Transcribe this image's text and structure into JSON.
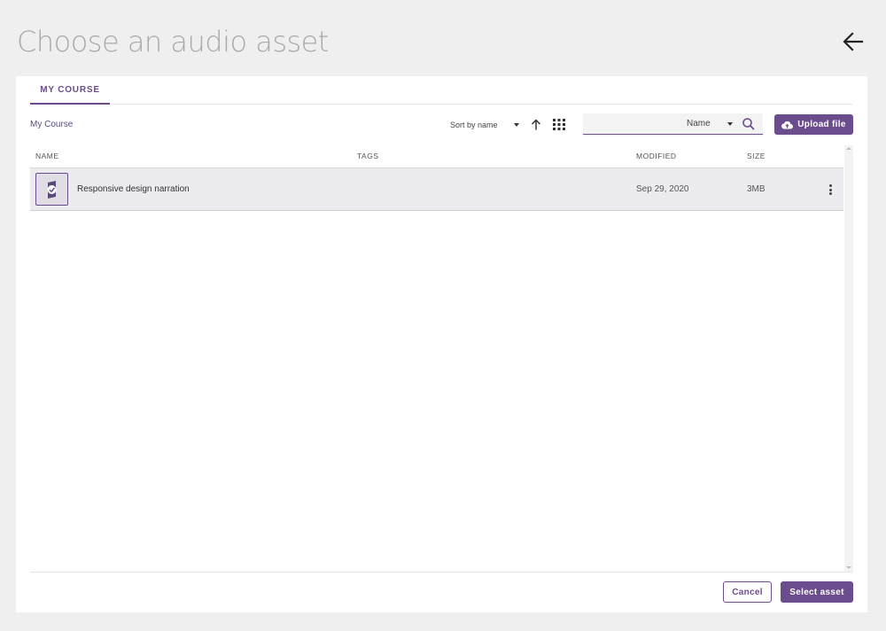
{
  "dialog": {
    "title": "Choose an audio asset",
    "back_icon": "arrow-left-icon"
  },
  "tabs": [
    {
      "label": "MY COURSE",
      "active": true
    }
  ],
  "toolbar": {
    "breadcrumb": "My Course",
    "sort_label": "Sort by name",
    "sort_direction_icon": "arrow-up-icon",
    "view_icon": "grid-view-icon",
    "search": {
      "value": "",
      "placeholder": "",
      "field_label": "Name",
      "icon": "search-icon"
    },
    "upload_label": "Upload file",
    "upload_icon": "cloud-upload-icon"
  },
  "table": {
    "columns": {
      "name": "NAME",
      "tags": "TAGS",
      "modified": "MODIFIED",
      "size": "SIZE"
    },
    "rows": [
      {
        "name": "Responsive design narration",
        "tags": "",
        "modified": "Sep 29, 2020",
        "size": "3MB",
        "icon": "audio-file-icon",
        "selected": true
      }
    ]
  },
  "footer": {
    "cancel_label": "Cancel",
    "select_label": "Select asset"
  },
  "colors": {
    "accent": "#6b4c8c",
    "background": "#efefef",
    "selected_row": "#ecebef"
  }
}
